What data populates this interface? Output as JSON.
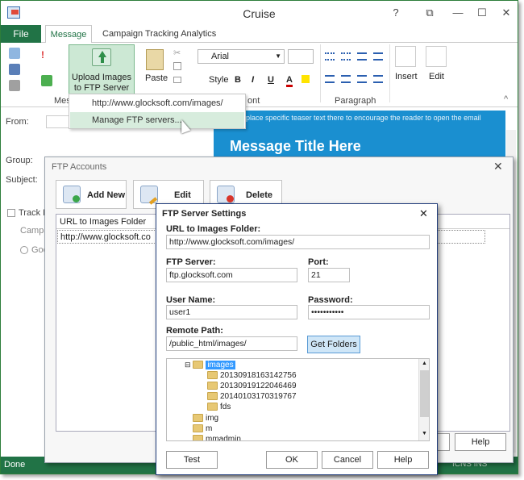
{
  "window": {
    "title": "Cruise",
    "help_icon": "?",
    "restore_icon": "⧉",
    "minimize_icon": "—",
    "maximize_icon": "☐",
    "close_icon": "✕"
  },
  "tabs": {
    "file": "File",
    "message": "Message",
    "campaign": "Campaign Tracking Analytics"
  },
  "ribbon": {
    "upload_label": "Upload Images to FTP Server",
    "upload_arrow": "▾",
    "paste_label": "Paste",
    "font_name": "Arial",
    "style_label": "Style",
    "bold": "B",
    "italic": "I",
    "underline": "U",
    "font_color": "A",
    "insert_label": "Insert",
    "edit_label": "Edit",
    "group_message": "Mes",
    "group_font": "ont",
    "group_paragraph": "Paragraph",
    "collapse": "^"
  },
  "dropdown": {
    "url": "http://www.glocksoft.com/images/",
    "manage": "Manage FTP servers..."
  },
  "fields": {
    "from": "From:",
    "group": "Group:",
    "subject": "Subject:",
    "track": "Track R",
    "campaign": "Campa",
    "goo": "Goo"
  },
  "email_preview": {
    "teaser": "place specific teaser text there to encourage the reader to open the email",
    "title": "Message Title Here"
  },
  "status": {
    "text": "Done",
    "right": "ICNS   INS"
  },
  "ftp_accounts": {
    "title": "FTP Accounts",
    "close": "✕",
    "add": "Add New",
    "edit": "Edit",
    "delete": "Delete",
    "column": "URL to Images Folder",
    "row": "http://www.glocksoft.co",
    "help": "Help"
  },
  "ftp_settings": {
    "title": "FTP Server Settings",
    "close": "✕",
    "url_label": "URL to Images Folder:",
    "url_value": "http://www.glocksoft.com/images/",
    "server_label": "FTP Server:",
    "server_value": "ftp.glocksoft.com",
    "port_label": "Port:",
    "port_value": "21",
    "user_label": "User Name:",
    "user_value": "user1",
    "password_label": "Password:",
    "password_value": "•••••••••••",
    "remote_label": "Remote Path:",
    "remote_value": "/public_html/images/",
    "get_folders": "Get Folders",
    "tree": {
      "selected": "images",
      "children": [
        "20130918163142756",
        "20130919122046469",
        "20140103170319767",
        "fds"
      ],
      "siblings": [
        "img",
        "m",
        "mmadmin"
      ]
    },
    "test": "Test",
    "ok": "OK",
    "cancel": "Cancel",
    "help": "Help"
  }
}
